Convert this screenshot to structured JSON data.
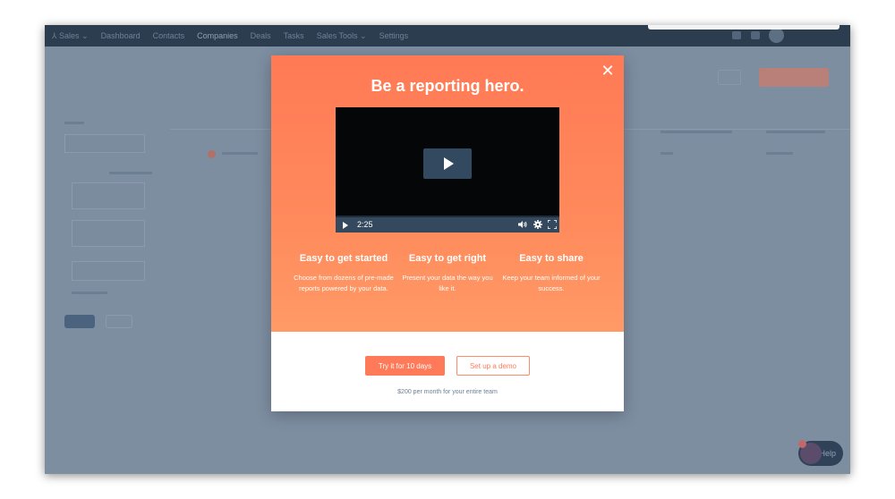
{
  "nav": {
    "items": [
      {
        "label": "Dashboard"
      },
      {
        "label": "Contacts"
      },
      {
        "label": "Companies"
      },
      {
        "label": "Deals"
      },
      {
        "label": "Tasks"
      },
      {
        "label": "Sales Tools ⌄"
      },
      {
        "label": "Settings"
      }
    ],
    "brand": "⅄ Sales ⌄"
  },
  "modal": {
    "title": "Be a reporting hero.",
    "video": {
      "time": "2:25"
    },
    "features": [
      {
        "heading": "Easy to get started",
        "desc": "Choose from dozens of pre-made reports powered by your data."
      },
      {
        "heading": "Easy to get right",
        "desc": "Present your data the way you like it."
      },
      {
        "heading": "Easy to share",
        "desc": "Keep your team informed of your success."
      }
    ],
    "try_label": "Try it for 10 days",
    "demo_label": "Set up a demo",
    "price_note": "$200 per month for your entire team"
  },
  "help": {
    "label": "Help"
  },
  "colors": {
    "accent": "#ff7a59",
    "nav_bg": "#2d3d50",
    "video_bar": "#34495e"
  }
}
